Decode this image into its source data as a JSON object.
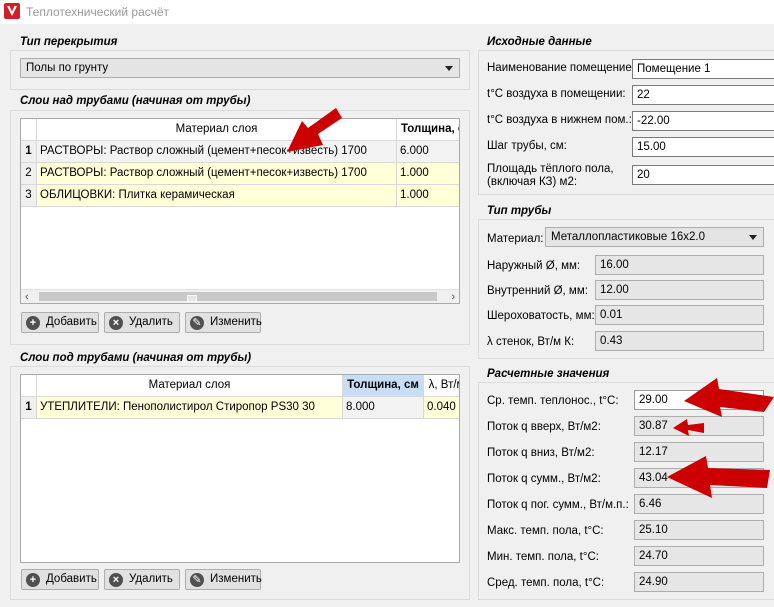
{
  "window": {
    "title": "Теплотехнический расчёт",
    "icon": "app-logo-icon"
  },
  "floor_type": {
    "title": "Тип перекрытия",
    "selected": "Полы по грунту"
  },
  "layers_above": {
    "title": "Слои над трубами (начиная от трубы)",
    "columns": [
      "Материал слоя",
      "Толщина, см"
    ],
    "rows": [
      {
        "num": "1",
        "material": "РАСТВОРЫ: Раствор сложный (цемент+песок+известь) 1700",
        "thickness": "6.000"
      },
      {
        "num": "2",
        "material": "РАСТВОРЫ: Раствор сложный (цемент+песок+известь) 1700",
        "thickness": "1.000"
      },
      {
        "num": "3",
        "material": "ОБЛИЦОВКИ: Плитка керамическая",
        "thickness": "1.000"
      }
    ],
    "buttons": {
      "add": "Добавить",
      "delete": "Удалить",
      "edit": "Изменить"
    }
  },
  "layers_below": {
    "title": "Слои под трубами (начиная от трубы)",
    "columns": [
      "Материал слоя",
      "Толщина, см",
      "λ, Вт/м К"
    ],
    "rows": [
      {
        "num": "1",
        "material": "УТЕПЛИТЕЛИ: Пенополистирол Стиропор PS30 30",
        "thickness": "8.000",
        "lambda": "0.040"
      }
    ],
    "buttons": {
      "add": "Добавить",
      "delete": "Удалить",
      "edit": "Изменить"
    }
  },
  "source_data": {
    "title": "Исходные данные",
    "room_name_label": "Наименование помещение:",
    "room_name": "Помещение 1",
    "room_temp_label": "t°C воздуха в помещении:",
    "room_temp": "22",
    "lower_temp_label": "t°C воздуха в нижнем пом.:",
    "lower_temp": "-22.00",
    "pipe_step_label": "Шаг трубы, см:",
    "pipe_step": "15.00",
    "area_label_1": "Площадь тёплого пола,",
    "area_label_2": "(включая КЗ) м2:",
    "area": "20"
  },
  "pipe_type": {
    "title": "Тип трубы",
    "material_label": "Материал:",
    "material": "Металлопластиковые 16x2.0",
    "outer_label": "Наружный Ø, мм:",
    "outer": "16.00",
    "inner_label": "Внутренний Ø, мм:",
    "inner": "12.00",
    "rough_label": "Шероховатость, мм:",
    "rough": "0.01",
    "lambda_label": "λ стенок, Вт/м К:",
    "lambda": "0.43"
  },
  "results": {
    "title": "Расчетные значения",
    "avg_temp_label": "Ср. темп. теплонос., t°C:",
    "avg_temp": "29.00",
    "flow_up_label": "Поток q вверх, Вт/м2:",
    "flow_up": "30.87",
    "flow_down_label": "Поток q вниз, Вт/м2:",
    "flow_down": "12.17",
    "flow_sum_label": "Поток q сумм., Вт/м2:",
    "flow_sum": "43.04",
    "flow_lin_label": "Поток q пог. сумм., Вт/м.п.:",
    "flow_lin": "6.46",
    "max_temp_label": "Макс. темп. пола, t°C:",
    "max_temp": "25.10",
    "min_temp_label": "Мин. темп. пола, t°C:",
    "min_temp": "24.70",
    "mean_temp_label": "Сред. темп. пола, t°C:",
    "mean_temp": "24.90"
  },
  "colors": {
    "annotation_arrow": "#cc0000",
    "row_highlight": "#ffffd8",
    "sorted_header": "#c8def6"
  }
}
